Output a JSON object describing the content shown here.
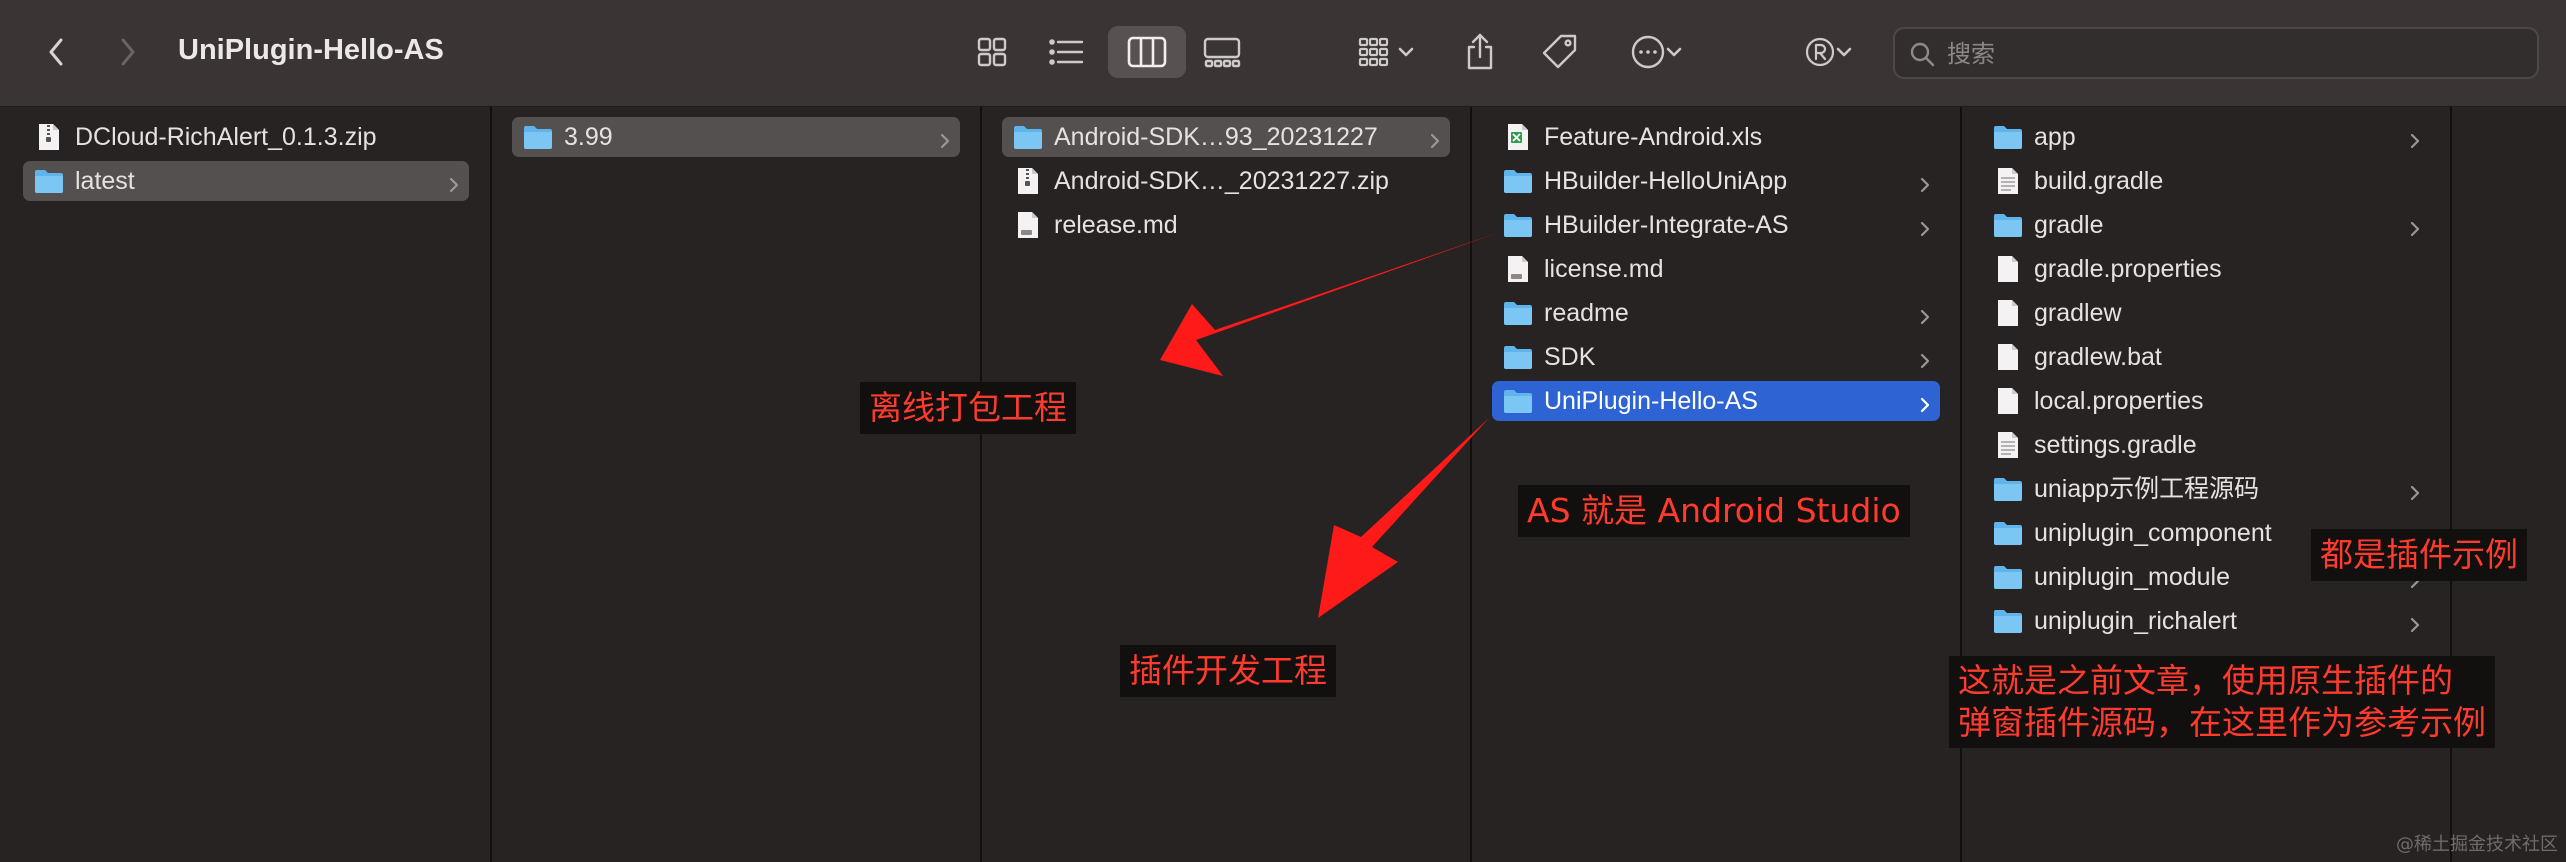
{
  "window": {
    "title": "UniPlugin-Hello-AS"
  },
  "toolbar": {
    "back_icon": "chevron-left-icon",
    "forward_icon": "chevron-right-icon",
    "view_icons": [
      "grid-view-icon",
      "list-view-icon",
      "column-view-icon",
      "gallery-view-icon"
    ],
    "active_view": "column-view-icon",
    "group_icon": "group-by-icon",
    "share_icon": "share-icon",
    "tag_icon": "tag-icon",
    "more_icon": "ellipsis-circle-icon",
    "extension_icon": "registered-icon"
  },
  "search": {
    "placeholder": "搜索",
    "value": ""
  },
  "columns": [
    {
      "items": [
        {
          "name": "DCloud-RichAlert_0.1.3.zip",
          "type": "zip",
          "chevron": false,
          "selected": "none"
        },
        {
          "name": "latest",
          "type": "folder",
          "chevron": true,
          "selected": "gray"
        }
      ]
    },
    {
      "items": [
        {
          "name": "3.99",
          "type": "folder",
          "chevron": true,
          "selected": "gray"
        }
      ]
    },
    {
      "items": [
        {
          "name": "Android-SDK…93_20231227",
          "type": "folder",
          "chevron": true,
          "selected": "gray"
        },
        {
          "name": "Android-SDK…_20231227.zip",
          "type": "zip",
          "chevron": false,
          "selected": "none"
        },
        {
          "name": "release.md",
          "type": "md",
          "chevron": false,
          "selected": "none"
        }
      ]
    },
    {
      "items": [
        {
          "name": "Feature-Android.xls",
          "type": "xls",
          "chevron": false,
          "selected": "none"
        },
        {
          "name": "HBuilder-HelloUniApp",
          "type": "folder",
          "chevron": true,
          "selected": "none"
        },
        {
          "name": "HBuilder-Integrate-AS",
          "type": "folder",
          "chevron": true,
          "selected": "none"
        },
        {
          "name": "license.md",
          "type": "md",
          "chevron": false,
          "selected": "none"
        },
        {
          "name": "readme",
          "type": "folder",
          "chevron": true,
          "selected": "none"
        },
        {
          "name": "SDK",
          "type": "folder",
          "chevron": true,
          "selected": "none"
        },
        {
          "name": "UniPlugin-Hello-AS",
          "type": "folder",
          "chevron": true,
          "selected": "blue"
        }
      ]
    },
    {
      "items": [
        {
          "name": "app",
          "type": "folder",
          "chevron": true,
          "selected": "none"
        },
        {
          "name": "build.gradle",
          "type": "doc",
          "chevron": false,
          "selected": "none"
        },
        {
          "name": "gradle",
          "type": "folder",
          "chevron": true,
          "selected": "none"
        },
        {
          "name": "gradle.properties",
          "type": "blank",
          "chevron": false,
          "selected": "none"
        },
        {
          "name": "gradlew",
          "type": "blank",
          "chevron": false,
          "selected": "none"
        },
        {
          "name": "gradlew.bat",
          "type": "blank",
          "chevron": false,
          "selected": "none"
        },
        {
          "name": "local.properties",
          "type": "blank",
          "chevron": false,
          "selected": "none"
        },
        {
          "name": "settings.gradle",
          "type": "doc",
          "chevron": false,
          "selected": "none"
        },
        {
          "name": "uniapp示例工程源码",
          "type": "folder",
          "chevron": true,
          "selected": "none"
        },
        {
          "name": "uniplugin_component",
          "type": "folder",
          "chevron": true,
          "selected": "none"
        },
        {
          "name": "uniplugin_module",
          "type": "folder",
          "chevron": true,
          "selected": "none"
        },
        {
          "name": "uniplugin_richalert",
          "type": "folder",
          "chevron": true,
          "selected": "none"
        }
      ]
    }
  ],
  "annotations": {
    "offline_packaging": "离线打包工程",
    "plugin_development": "插件开发工程",
    "as_meaning": "AS 就是 Android Studio",
    "plugin_examples": "都是插件示例",
    "popup_source_line1": "这就是之前文章，使用原生插件的",
    "popup_source_line2": "弹窗插件源码，在这里作为参考示例"
  },
  "colors": {
    "annotation_text": "#ff3b2e",
    "annotation_bg": "#120f0f",
    "arrow": "#ff1a1a",
    "selection_blue": "#2d63d3",
    "selection_gray": "#545050",
    "folder": "#5fb4ec"
  },
  "watermark": "@稀土掘金技术社区"
}
